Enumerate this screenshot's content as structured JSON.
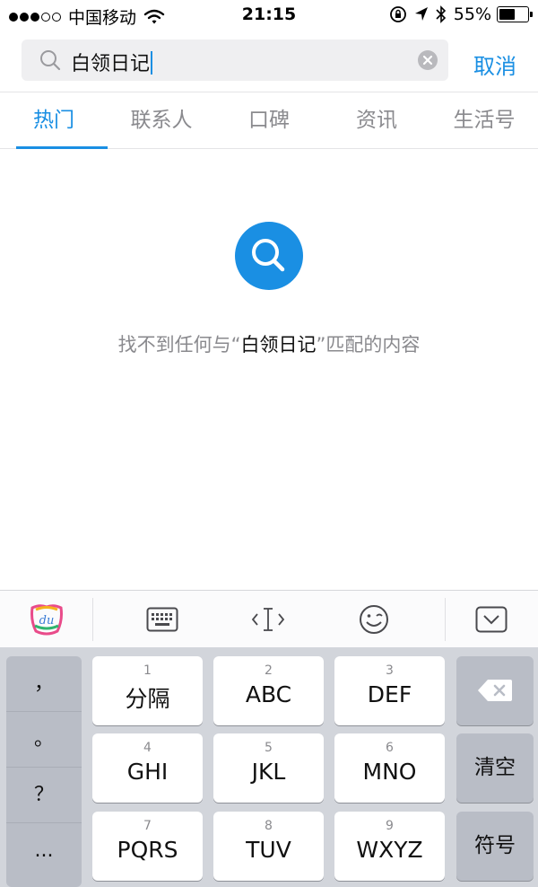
{
  "status_bar": {
    "carrier": "中国移动",
    "time": "21:15",
    "battery_percent": "55%",
    "battery_level": 0.55,
    "signal_dots_filled": 3,
    "signal_dots_total": 5,
    "icons": [
      "wifi-icon",
      "rotation-lock-icon",
      "location-arrow-icon",
      "bluetooth-icon",
      "battery-icon"
    ]
  },
  "search": {
    "query": "白领日记",
    "cancel_label": "取消",
    "icons": [
      "search-icon",
      "clear-icon"
    ]
  },
  "tabs": [
    {
      "label": "热门",
      "active": true
    },
    {
      "label": "联系人",
      "active": false
    },
    {
      "label": "口碑",
      "active": false
    },
    {
      "label": "资讯",
      "active": false
    },
    {
      "label": "生活号",
      "active": false
    }
  ],
  "empty_state": {
    "prefix": "找不到任何与“",
    "keyword": "白领日记",
    "suffix": "”匹配的内容",
    "icon": "search-icon"
  },
  "keyboard_toolbar": {
    "icons": [
      "du-logo-icon",
      "keyboard-icon",
      "cursor-icon",
      "emoji-icon",
      "collapse-keyboard-icon"
    ]
  },
  "keyboard": {
    "punctuation": [
      "，",
      "。",
      "？",
      "..."
    ],
    "keys": [
      {
        "num": "1",
        "label": "分隔"
      },
      {
        "num": "2",
        "label": "ABC"
      },
      {
        "num": "3",
        "label": "DEF"
      },
      {
        "num": "4",
        "label": "GHI"
      },
      {
        "num": "5",
        "label": "JKL"
      },
      {
        "num": "6",
        "label": "MNO"
      },
      {
        "num": "7",
        "label": "PQRS"
      },
      {
        "num": "8",
        "label": "TUV"
      },
      {
        "num": "9",
        "label": "WXYZ"
      }
    ],
    "clear_label": "清空",
    "symbols_label": "符号",
    "colors": {
      "accent": "#1a8fe3",
      "key_bg": "#ffffff",
      "keyboard_bg": "#d2d5db"
    }
  }
}
